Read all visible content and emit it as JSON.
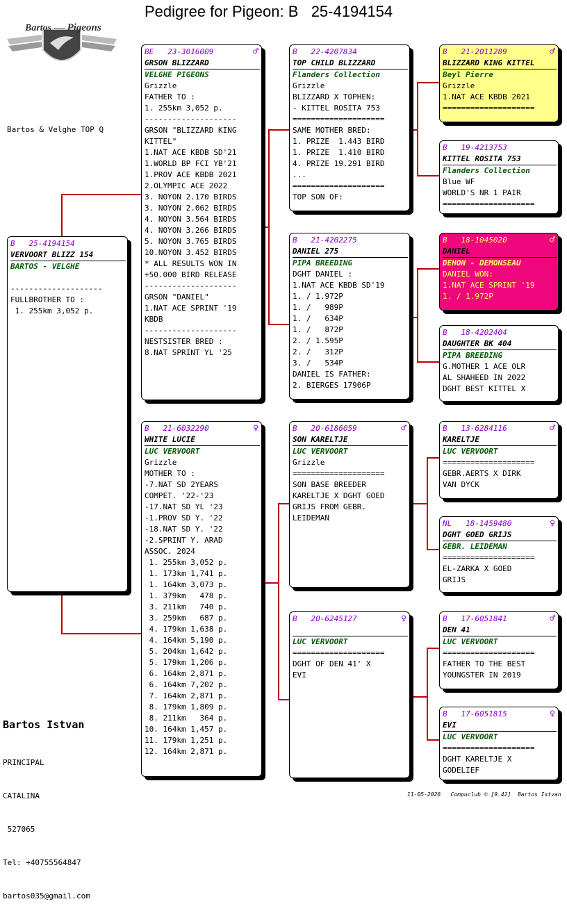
{
  "title": "Pedigree for Pigeon: B   25-4194154",
  "logo": {
    "word1": "Bartos",
    "word2": "Pigeons"
  },
  "subtitle": "Bartos & Velghe TOP Q",
  "footer": {
    "name": "Bartos Istvan",
    "lines": [
      "PRINCIPAL",
      "CATALINA",
      " 527065",
      "Tel: +40755564847",
      "bartos035@gmail.com"
    ]
  },
  "bottom_text": "11-05-2026   Compuclub © [9.42]  Bartos Istvan",
  "cards": {
    "main": {
      "country": "B",
      "ring": "25-4194154",
      "sex": "",
      "name": "VERVOORT BLIZZ 154",
      "breeder": "BARTOS - VELGHE",
      "lines": [
        "",
        "--------------------",
        "FULLBROTHER TO :",
        " 1. 255km 3,052 p."
      ]
    },
    "father": {
      "country": "BE",
      "ring": "23-3016009",
      "sex": "♂",
      "name": "GRSON BLIZZARD",
      "breeder": "VELGHE PIGEONS",
      "lines": [
        "Grizzle",
        "FATHER TO :",
        "1. 255km 3,052 p.",
        "--------------------",
        "GRSON \"BLIZZARD KING",
        "KITTEL\"",
        "1.NAT ACE KBDB SD'21",
        "1.WORLD BP FCI YB'21",
        "1.PROV ACE KBDB 2021",
        "2.OLYMPIC ACE 2022",
        "3. NOYON 2.170 BIRDS",
        "3. NOYON 2.062 BIRDS",
        "4. NOYON 3.564 BIRDS",
        "4. NOYON 3.266 BIRDS",
        "5. NOYON 3.765 BIRDS",
        "10.NOYON 3.452 BIRDS",
        "* ALL RESULTS WON IN",
        "+50.000 BIRD RELEASE",
        "--------------------",
        "GRSON \"DANIEL\"",
        "1.NAT ACE SPRINT '19",
        "KBDB",
        "--------------------",
        "NESTSISTER BRED :",
        "8.NAT SPRINT YL '25"
      ]
    },
    "mother": {
      "country": "B",
      "ring": "21-6032290",
      "sex": "♀",
      "name": "WHITE LUCIE",
      "breeder": "LUC VERVOORT",
      "lines": [
        "Grizzle",
        "MOTHER TO :",
        "-7.NAT SD 2YEARS",
        "COMPET. '22-'23",
        "-17.NAT SD YL '23",
        "-1.PROV SD Y. '22",
        "-18.NAT SD Y. '22",
        "-2.SPRINT Y. ARAD",
        "ASSOC. 2024",
        " 1. 255km 3,052 p.",
        " 1. 173km 1,741 p.",
        " 1. 164km 3,073 p.",
        " 1. 379km   478 p.",
        " 3. 211km   740 p.",
        " 3. 259km   687 p.",
        " 4. 179km 1,638 p.",
        " 4. 164km 5,190 p.",
        " 5. 204km 1,642 p.",
        " 5. 179km 1,206 p.",
        " 6. 164km 2,871 p.",
        " 6. 164km 7,202 p.",
        " 7. 164km 2,871 p.",
        " 8. 179km 1,809 p.",
        " 8. 211km   364 p.",
        "10. 164km 1,457 p.",
        "11. 179km 1,251 p.",
        "12. 164km 2,871 p."
      ]
    },
    "ff": {
      "country": "B",
      "ring": "22-4207834",
      "sex": "",
      "name": "TOP CHILD BLIZZARD",
      "breeder": "Flanders Collection",
      "lines": [
        "Grizzle",
        "BLIZZARD X TOPHEN:",
        "- KITTEL ROSITA 753",
        "====================",
        "SAME MOTHER BRED:",
        "1. PRIZE  1.443 BIRD",
        "1. PRIZE  1.410 BIRD",
        "4. PRIZE 19.291 BIRD",
        "...",
        "====================",
        "TOP SON OF:"
      ]
    },
    "fm": {
      "country": "B",
      "ring": "21-4202275",
      "sex": "",
      "name": "DANIEL 275",
      "breeder": "PIPA BREEDING",
      "lines": [
        "DGHT DANIEL :",
        "1.NAT ACE KBDB SD'19",
        "1. / 1.972P",
        "1. /   989P",
        "1. /   634P",
        "1. /   872P",
        "2. / 1.595P",
        "2. /   312P",
        "3. /   534P",
        "DANIEL IS FATHER:",
        "2. BIERGES 17906P"
      ]
    },
    "mf": {
      "country": "B",
      "ring": "20-6186059",
      "sex": "♂",
      "name": "SON KARELTJE",
      "breeder": "LUC VERVOORT",
      "lines": [
        "Grizzle",
        "====================",
        "SON BASE BREEDER",
        "KARELTJE X DGHT GOED",
        "GRIJS FROM GEBR.",
        "LEIDEMAN"
      ]
    },
    "mm": {
      "country": "B",
      "ring": "20-6245127",
      "sex": "♀",
      "name": "",
      "breeder": "LUC VERVOORT",
      "lines": [
        "====================",
        "DGHT OF DEN 41' X",
        "EVI"
      ]
    },
    "fff": {
      "country": "B",
      "ring": "21-2011289",
      "sex": "♂",
      "name": "BLIZZARD KING KITTEL",
      "breeder": "Beyl Pierre",
      "lines": [
        "Grizzle",
        "1.NAT ACE KBDB 2021",
        "===================="
      ]
    },
    "ffm": {
      "country": "B",
      "ring": "19-4213753",
      "sex": "",
      "name": "KITTEL ROSITA 753",
      "breeder": "Flanders Collection",
      "lines": [
        "Blue WF",
        "WORLD'S NR 1 PAIR",
        "===================="
      ]
    },
    "fmf": {
      "country": "B",
      "ring": "18-1045020",
      "sex": "♂",
      "name": "DANIEL",
      "breeder": "DEHON - DEMONSEAU",
      "lines": [
        "DANIEL WON:",
        "1.NAT ACE SPRINT '19",
        "1. / 1.972P"
      ]
    },
    "fmm": {
      "country": "B",
      "ring": "18-4202404",
      "sex": "",
      "name": "DAUGHTER BK 404",
      "breeder": "PIPA BREEDING",
      "lines": [
        "G.MOTHER 1 ACE OLR",
        "AL SHAHEED IN 2022",
        "DGHT BEST KITTEL X"
      ]
    },
    "mff": {
      "country": "B",
      "ring": "13-6284116",
      "sex": "♂",
      "name": "KARELTJE",
      "breeder": "LUC VERVOORT",
      "lines": [
        "====================",
        "GEBR.AERTS X DIRK",
        "VAN DYCK"
      ]
    },
    "mfm": {
      "country": "NL",
      "ring": "18-1459480",
      "sex": "♀",
      "name": "DGHT GOED GRIJS",
      "breeder": "GEBR. LEIDEMAN",
      "lines": [
        "====================",
        "EL-ZARKA X GOED",
        "GRIJS"
      ]
    },
    "mmf": {
      "country": "B",
      "ring": "17-6051841",
      "sex": "♂",
      "name": "DEN 41",
      "breeder": "LUC VERVOORT",
      "lines": [
        "====================",
        "FATHER TO THE BEST",
        "YOUNGSTER IN 2019"
      ]
    },
    "mmm": {
      "country": "B",
      "ring": "17-6051815",
      "sex": "♀",
      "name": "EVI",
      "breeder": "LUC VERVOORT",
      "lines": [
        "====================",
        "DGHT KARELTJE X",
        "GODELIEF"
      ]
    }
  }
}
